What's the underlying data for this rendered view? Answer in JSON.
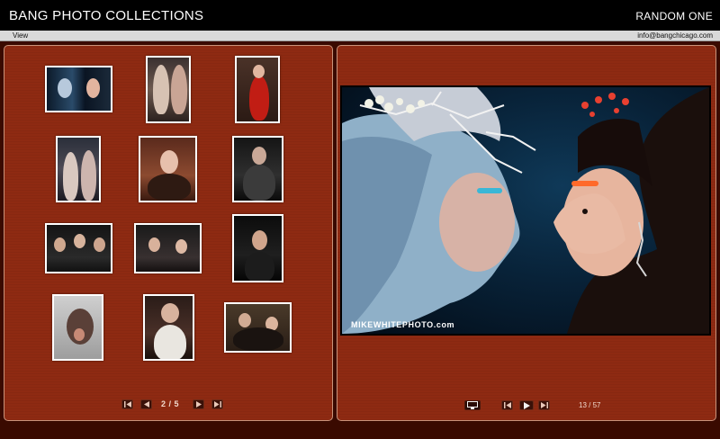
{
  "header": {
    "title": "BANG PHOTO COLLECTIONS",
    "random_label": "RANDOM ONE"
  },
  "menubar": {
    "view_label": "View",
    "email": "info@bangchicago.com"
  },
  "gallery": {
    "page_label": "2 / 5",
    "thumbnails": [
      {
        "id": "t1"
      },
      {
        "id": "t2"
      },
      {
        "id": "t3"
      },
      {
        "id": "t4"
      },
      {
        "id": "t5"
      },
      {
        "id": "t6"
      },
      {
        "id": "t7"
      },
      {
        "id": "t8"
      },
      {
        "id": "t9"
      },
      {
        "id": "t10"
      },
      {
        "id": "t11"
      },
      {
        "id": "t12"
      }
    ]
  },
  "viewer": {
    "counter": "13 / 57",
    "watermark": "MIKEWHITEPHOTO.com"
  },
  "colors": {
    "panel_bg": "#8e2a12",
    "panel_border": "#c9927a",
    "workspace_bg": "#3a0a00"
  }
}
